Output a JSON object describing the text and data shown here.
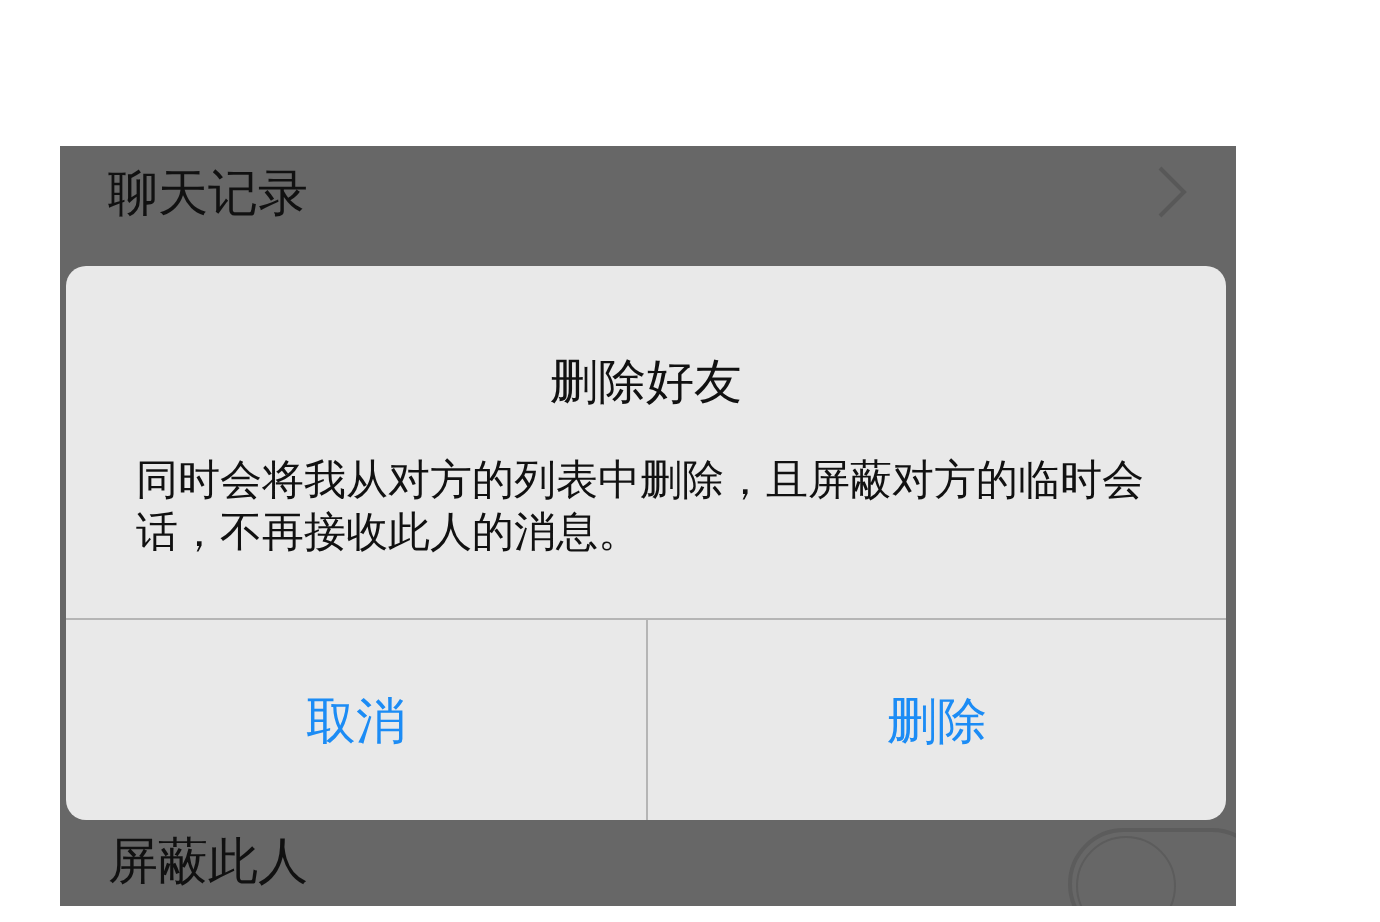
{
  "settings_list": [
    {
      "kind": "link",
      "label": "聊天记录"
    },
    {
      "kind": "toggle",
      "label": "屏蔽此人",
      "on": false
    }
  ],
  "dialog": {
    "title": "删除好友",
    "message": "同时会将我从对方的列表中删除，且屏蔽对方的临时会话，不再接收此人的消息。",
    "buttons": [
      {
        "label": "取消"
      },
      {
        "label": "删除"
      }
    ]
  }
}
